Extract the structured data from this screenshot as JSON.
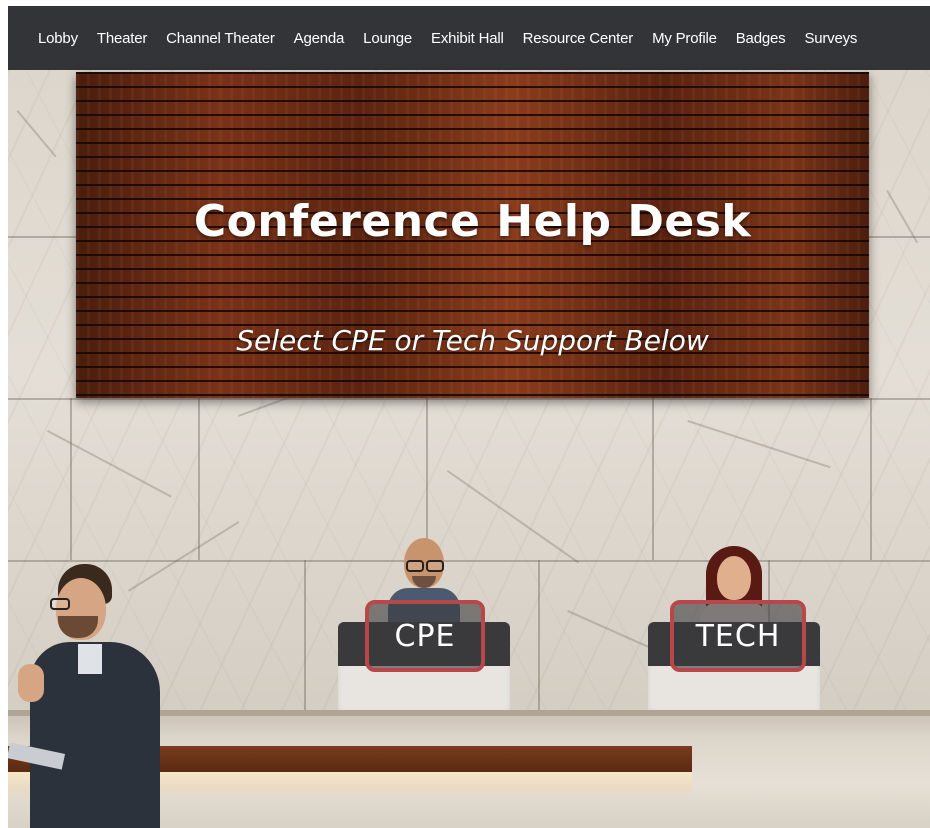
{
  "nav": {
    "items": [
      {
        "label": "Lobby"
      },
      {
        "label": "Theater"
      },
      {
        "label": "Channel Theater"
      },
      {
        "label": "Agenda"
      },
      {
        "label": "Lounge"
      },
      {
        "label": "Exhibit Hall"
      },
      {
        "label": "Resource Center"
      },
      {
        "label": "My Profile"
      },
      {
        "label": "Badges"
      },
      {
        "label": "Surveys"
      }
    ]
  },
  "sign": {
    "title": "Conference Help Desk",
    "subtitle": "Select CPE or Tech Support Below"
  },
  "desk": {
    "cpe_label": "CPE",
    "tech_label": "TECH"
  },
  "colors": {
    "nav_bg": "#323437",
    "highlight_border": "#b8474a",
    "sign_wood": "#6a2c14"
  }
}
